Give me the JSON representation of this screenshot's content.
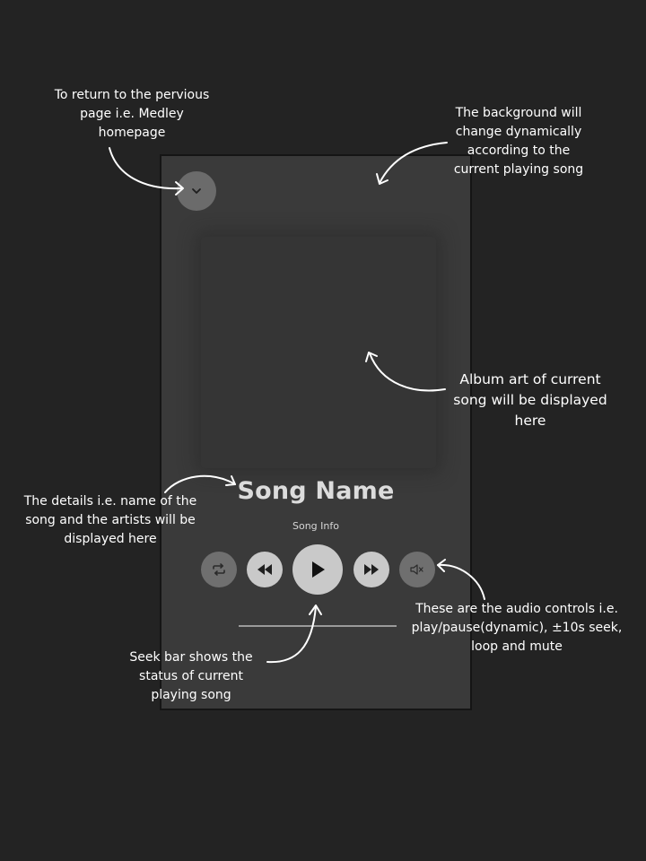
{
  "player": {
    "song_name": "Song Name",
    "song_info": "Song Info",
    "seek_progress": 0.0,
    "controls": {
      "back": "chevron-down-icon",
      "loop": "repeat-icon",
      "rewind": "rewind-icon",
      "play": "play-icon",
      "forward": "fast-forward-icon",
      "mute": "mute-icon"
    }
  },
  "annotations": {
    "back": "To return to the pervious\npage  i.e. Medley\nhomepage",
    "background": "The background will\nchange dynamically\naccording to the\ncurrent playing song",
    "album_art": "Album art of current\nsong will be displayed\nhere",
    "details": "The details i.e. name of the\nsong and the artists will be\ndisplayed here",
    "audio_controls": "These are the audio controls i.e.\nplay/pause(dynamic), ±10s seek,\nloop and mute",
    "seek_bar": "Seek bar shows the\nstatus of current\nplaying song"
  },
  "colors": {
    "page_background": "#232323",
    "player_background": "#3a3a3a",
    "control_dark": "#6f6f6f",
    "control_light": "#c9c9c9",
    "annotation_text": "#ffffff"
  }
}
